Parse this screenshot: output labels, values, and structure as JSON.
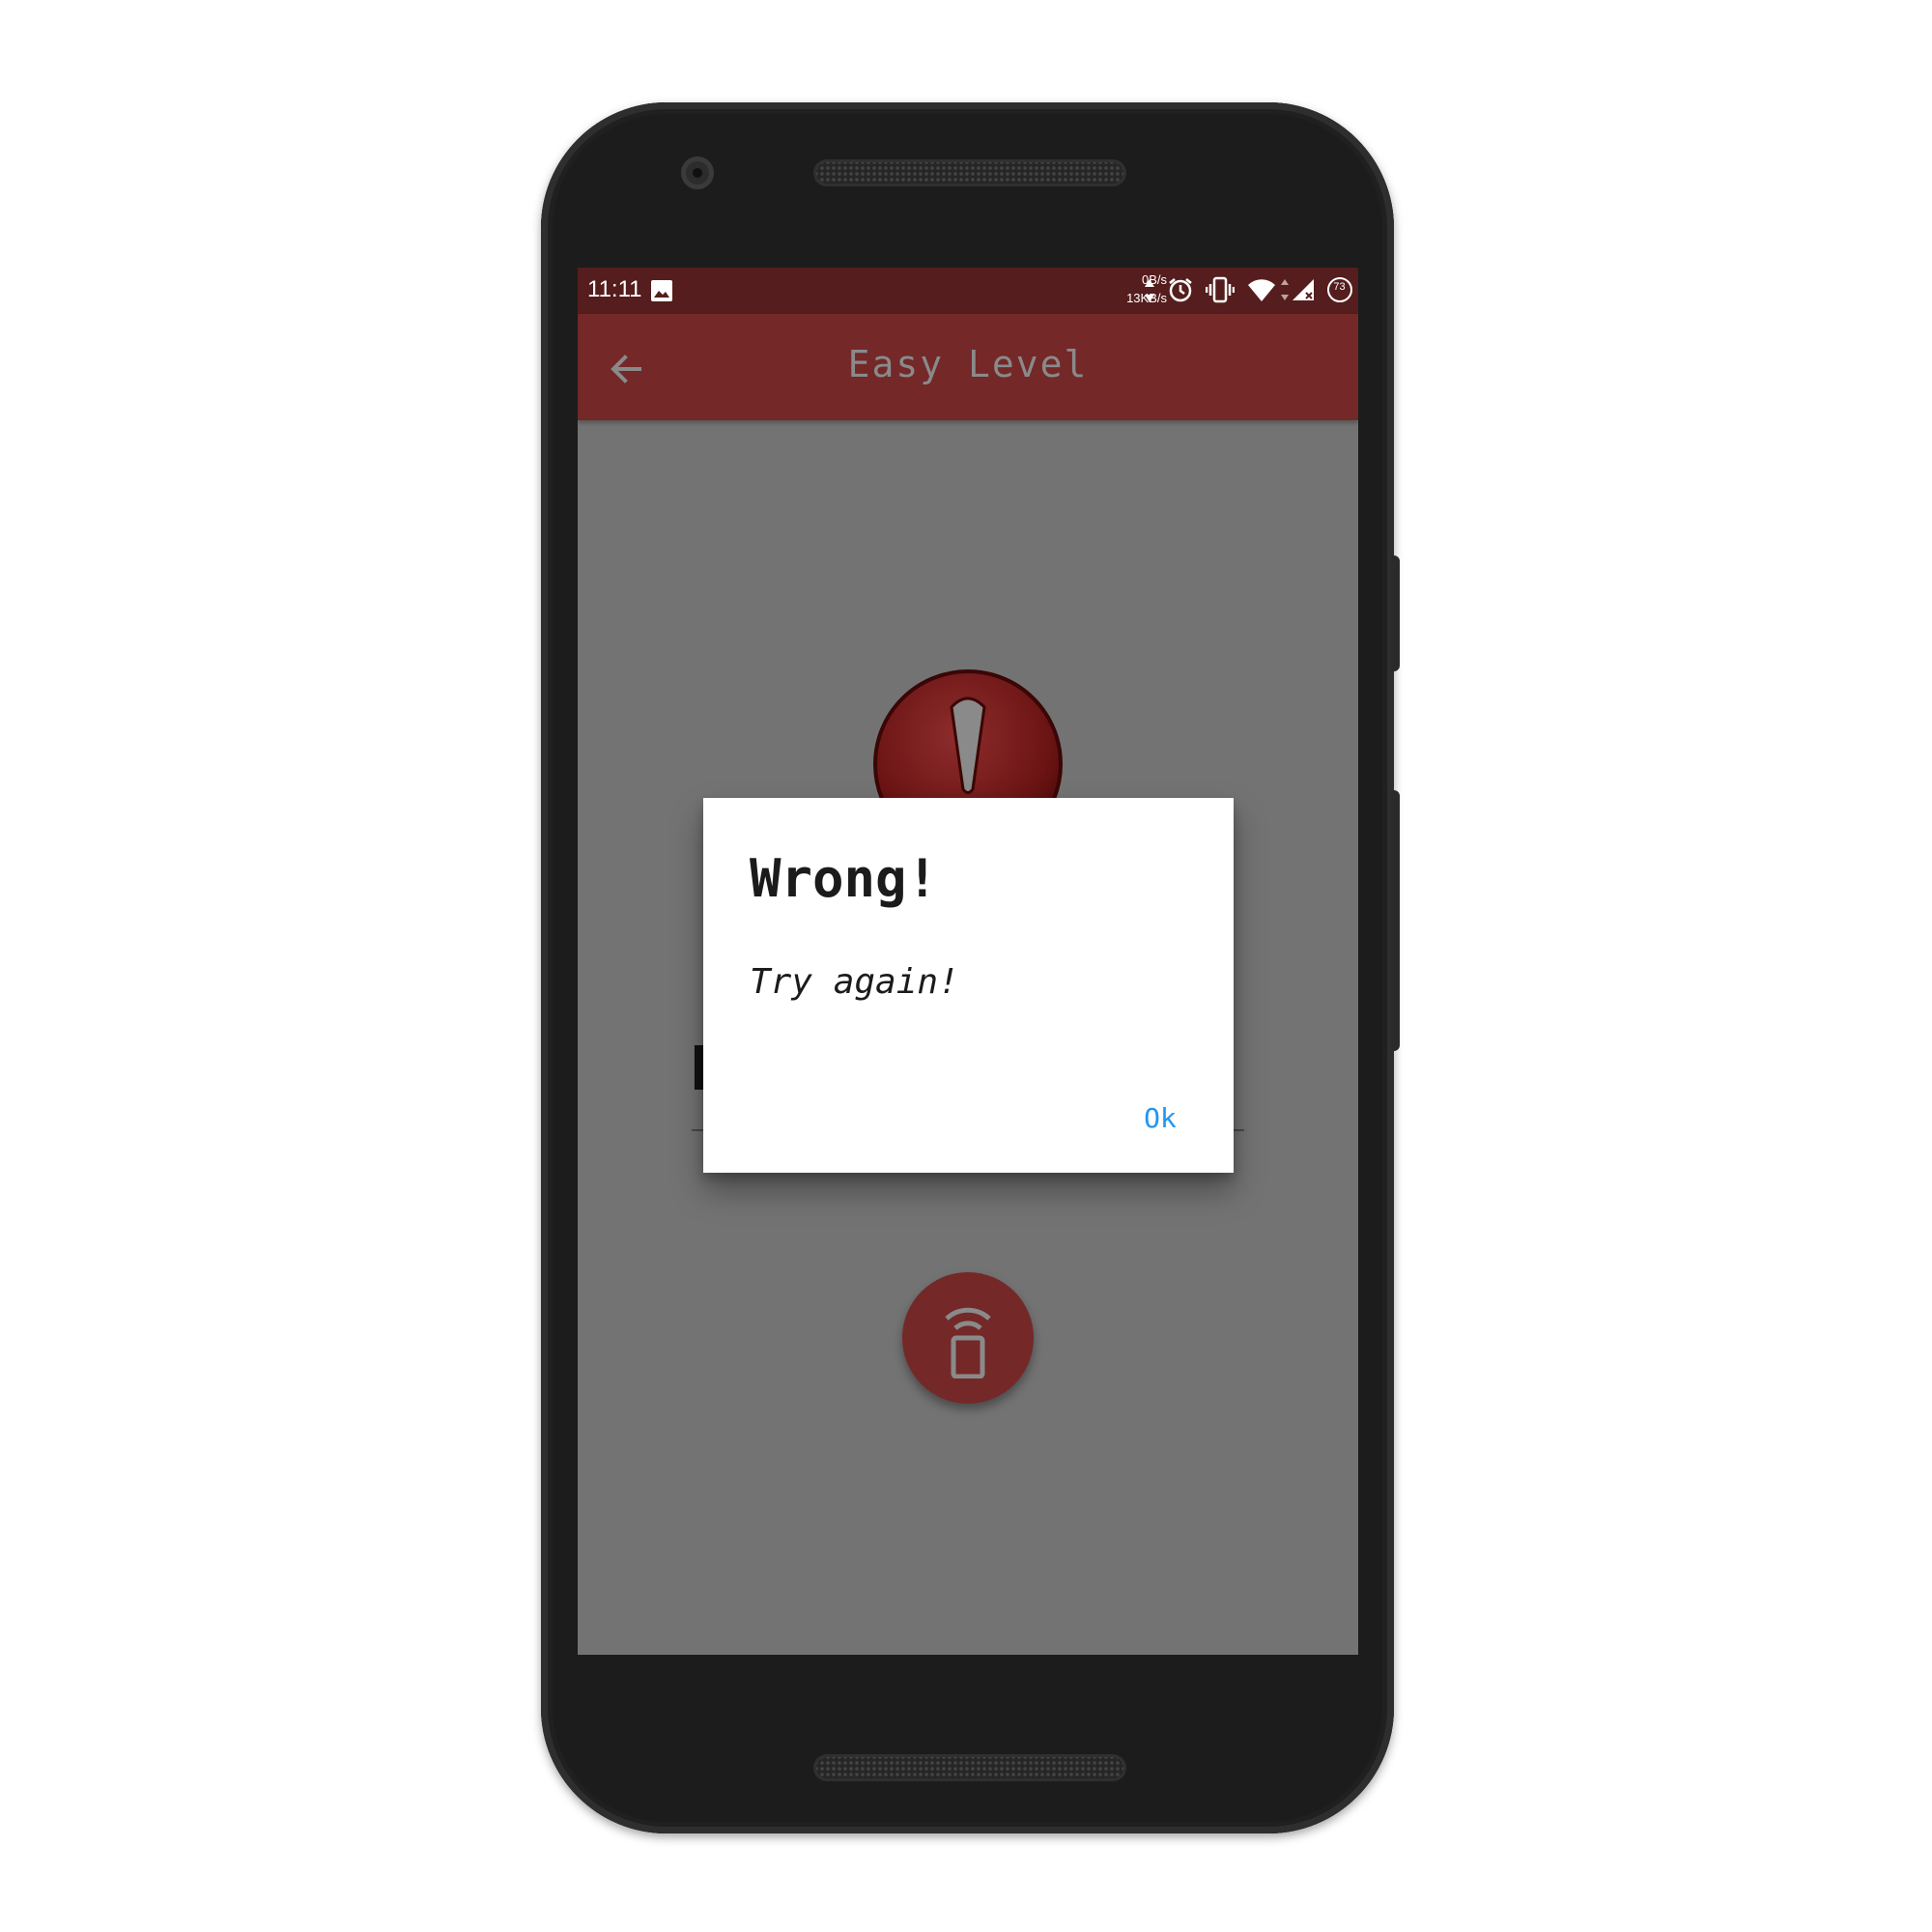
{
  "status_bar": {
    "time": "11:11",
    "net_up": "0B/s",
    "net_down": "13KB/s",
    "battery": "73",
    "icons": [
      "image-icon",
      "data-arrows-icon",
      "alarm-icon",
      "vibrate-icon",
      "wifi-icon",
      "signal-icon",
      "battery-icon"
    ]
  },
  "app_bar": {
    "title": "Easy Level",
    "back_icon": "arrow-left-icon"
  },
  "content": {
    "alert_icon": "exclamation-icon",
    "fab_icon": "phone-signal-icon"
  },
  "dialog": {
    "title": "Wrong!",
    "message": "Try again!",
    "ok_label": "Ok"
  },
  "colors": {
    "status_bar": "#551d1d",
    "app_bar": "#742828",
    "scrim": "#737373",
    "dialog_button": "#2196f3"
  }
}
